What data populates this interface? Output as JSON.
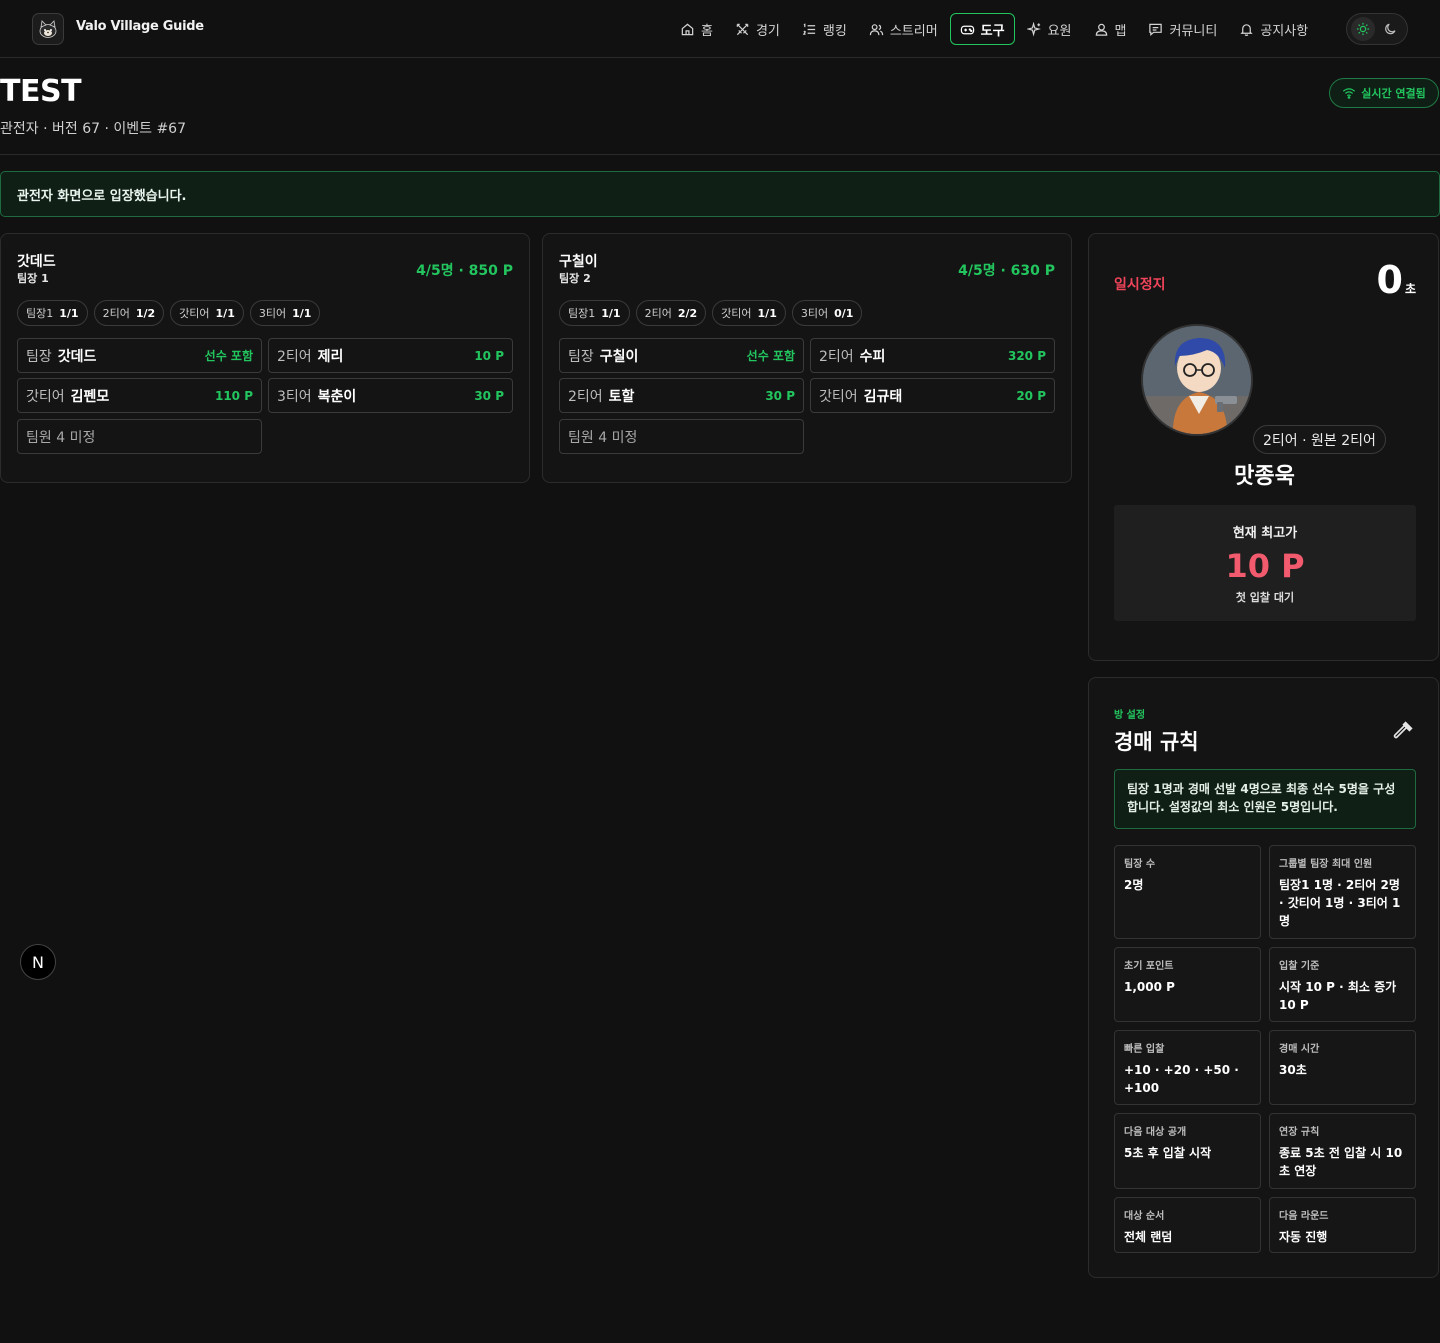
{
  "brand": {
    "name": "Valo Village Guide"
  },
  "nav": {
    "items": [
      {
        "label": "홈",
        "icon": "home-icon"
      },
      {
        "label": "경기",
        "icon": "swords-icon"
      },
      {
        "label": "랭킹",
        "icon": "list-ordered-icon"
      },
      {
        "label": "스트리머",
        "icon": "users-icon"
      },
      {
        "label": "도구",
        "icon": "gamepad-icon",
        "active": true
      },
      {
        "label": "요원",
        "icon": "sparkles-icon"
      },
      {
        "label": "맵",
        "icon": "map-user-icon"
      },
      {
        "label": "커뮤니티",
        "icon": "message-icon"
      },
      {
        "label": "공지사항",
        "icon": "bell-icon"
      }
    ]
  },
  "header": {
    "title": "TEST",
    "subtitle": "관전자 · 버전 67 · 이벤트 #67",
    "live_label": "실시간 연결됨"
  },
  "notice": "관전자 화면으로 입장했습니다.",
  "teams": [
    {
      "name": "갓데드",
      "captain_label": "팀장 1",
      "stat": "4/5명 · 850 P",
      "chips": [
        {
          "label": "팀장1",
          "value": "1/1"
        },
        {
          "label": "2티어",
          "value": "1/2"
        },
        {
          "label": "갓티어",
          "value": "1/1"
        },
        {
          "label": "3티어",
          "value": "1/1"
        }
      ],
      "slots": [
        {
          "role": "팀장",
          "name": "갓데드",
          "points": "선수 포함"
        },
        {
          "role": "2티어",
          "name": "제리",
          "points": "10 P"
        },
        {
          "role": "갓티어",
          "name": "김펜모",
          "points": "110 P"
        },
        {
          "role": "3티어",
          "name": "복춘이",
          "points": "30 P"
        },
        {
          "role": "팀원 4",
          "name": "",
          "points": "",
          "empty_label": "미정"
        }
      ]
    },
    {
      "name": "구칠이",
      "captain_label": "팀장 2",
      "stat": "4/5명 · 630 P",
      "chips": [
        {
          "label": "팀장1",
          "value": "1/1"
        },
        {
          "label": "2티어",
          "value": "2/2"
        },
        {
          "label": "갓티어",
          "value": "1/1"
        },
        {
          "label": "3티어",
          "value": "0/1"
        }
      ],
      "slots": [
        {
          "role": "팀장",
          "name": "구칠이",
          "points": "선수 포함"
        },
        {
          "role": "2티어",
          "name": "수피",
          "points": "320 P"
        },
        {
          "role": "2티어",
          "name": "토할",
          "points": "30 P"
        },
        {
          "role": "갓티어",
          "name": "김규태",
          "points": "20 P"
        },
        {
          "role": "팀원 4",
          "name": "",
          "points": "",
          "empty_label": "미정"
        }
      ]
    }
  ],
  "auction": {
    "status": "일시정지",
    "timer_value": "0",
    "timer_unit": "초",
    "tier_badge": "2티어 · 원본 2티어",
    "player_name": "맛종욱",
    "bid_label": "현재 최고가",
    "bid_value": "10 P",
    "bid_status": "첫 입찰 대기"
  },
  "rules": {
    "eyebrow": "방 설정",
    "title": "경매 규칙",
    "note": "팀장 1명과 경매 선발 4명으로 최종 선수 5명을 구성합니다. 설정값의 최소 인원은 5명입니다.",
    "items": [
      {
        "label": "팀장 수",
        "value": "2명"
      },
      {
        "label": "그룹별 팀장 최대 인원",
        "value": "팀장1 1명 · 2티어 2명 · 갓티어 1명 · 3티어 1명"
      },
      {
        "label": "초기 포인트",
        "value": "1,000 P"
      },
      {
        "label": "입찰 기준",
        "value": "시작 10 P · 최소 증가 10 P"
      },
      {
        "label": "빠른 입찰",
        "value": "+10 · +20 · +50 · +100"
      },
      {
        "label": "경매 시간",
        "value": "30초"
      },
      {
        "label": "다음 대상 공개",
        "value": "5초 후 입찰 시작"
      },
      {
        "label": "연장 규칙",
        "value": "종료 5초 전 입찰 시 10초 연장"
      },
      {
        "label": "대상 순서",
        "value": "전체 랜덤"
      },
      {
        "label": "다음 라운드",
        "value": "자동 진행"
      }
    ]
  },
  "fab_label": "N",
  "colors": {
    "accent": "#22c55e",
    "danger": "#f25a6d",
    "background": "#111111"
  }
}
